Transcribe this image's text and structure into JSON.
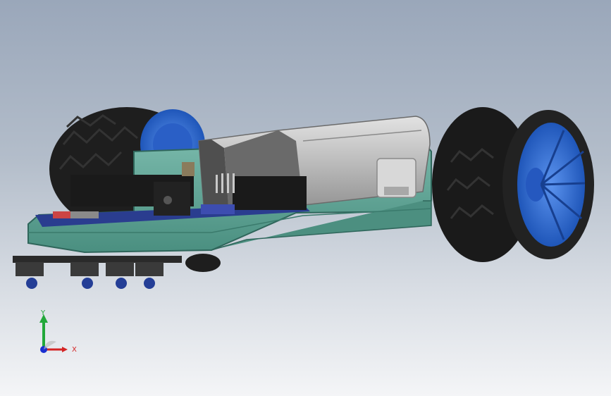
{
  "viewport": {
    "background_top": "#9aa7ba",
    "background_bottom": "#f4f5f7"
  },
  "model": {
    "colors": {
      "chassis": "#5fa394",
      "chassis_edge": "#3f7a6e",
      "tire": "#1d1d1d",
      "hub": "#2f6fd8",
      "motor_body": "#b9b9b9",
      "motor_dark": "#4f4f4f",
      "header": "#1a1a1a",
      "pcb": "#2a3d8f"
    },
    "parts": [
      "left-wheel",
      "right-wheel",
      "chassis",
      "motor",
      "control-board",
      "sensor-array"
    ]
  },
  "triad": {
    "y_label": "Y",
    "x_label": "X",
    "y_color": "#22a83a",
    "x_color": "#d42424",
    "z_color": "#1a2fd0"
  }
}
